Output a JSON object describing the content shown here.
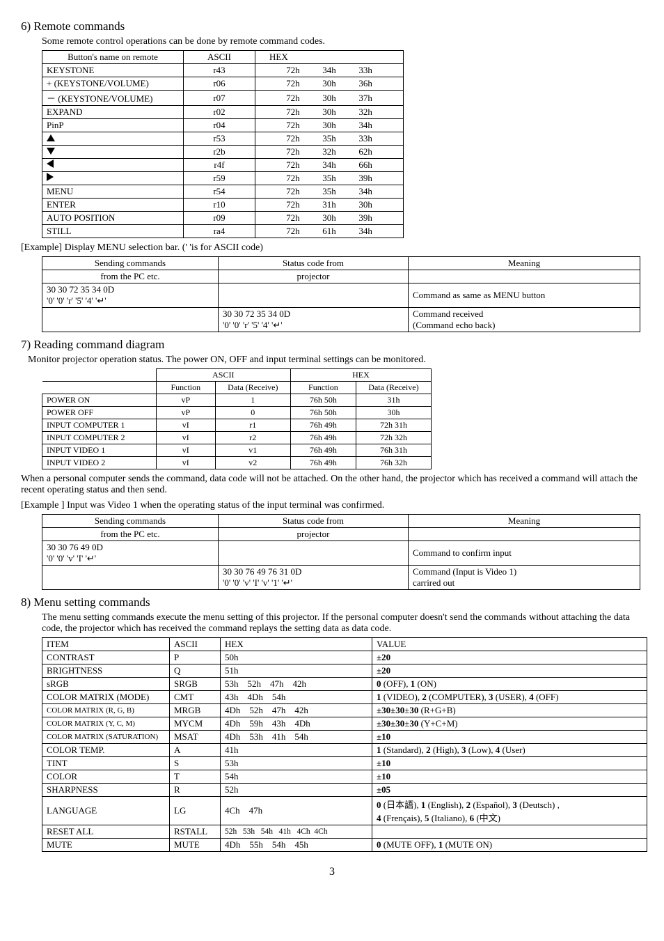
{
  "sec6": {
    "heading": "6) Remote commands",
    "intro": "Some remote control operations can be done by remote command codes.",
    "headers": [
      "Button's name on remote",
      "ASCII",
      "HEX",
      "",
      ""
    ],
    "rows": [
      {
        "name": "KEYSTONE",
        "icon": "",
        "ascii": "r43",
        "h1": "72h",
        "h2": "34h",
        "h3": "33h"
      },
      {
        "name": "+ (KEYSTONE/VOLUME)",
        "icon": "",
        "ascii": "r06",
        "h1": "72h",
        "h2": "30h",
        "h3": "36h"
      },
      {
        "name": "－ (KEYSTONE/VOLUME)",
        "icon": "",
        "ascii": "r07",
        "h1": "72h",
        "h2": "30h",
        "h3": "37h"
      },
      {
        "name": "EXPAND",
        "icon": "",
        "ascii": "r02",
        "h1": "72h",
        "h2": "30h",
        "h3": "32h"
      },
      {
        "name": "PinP",
        "icon": "",
        "ascii": "r04",
        "h1": "72h",
        "h2": "30h",
        "h3": "34h"
      },
      {
        "name": "",
        "icon": "up",
        "ascii": "r53",
        "h1": "72h",
        "h2": "35h",
        "h3": "33h"
      },
      {
        "name": "",
        "icon": "down",
        "ascii": "r2b",
        "h1": "72h",
        "h2": "32h",
        "h3": "62h"
      },
      {
        "name": "",
        "icon": "left",
        "ascii": "r4f",
        "h1": "72h",
        "h2": "34h",
        "h3": "66h"
      },
      {
        "name": "",
        "icon": "right",
        "ascii": "r59",
        "h1": "72h",
        "h2": "35h",
        "h3": "39h"
      },
      {
        "name": "MENU",
        "icon": "",
        "ascii": "r54",
        "h1": "72h",
        "h2": "35h",
        "h3": "34h"
      },
      {
        "name": "ENTER",
        "icon": "",
        "ascii": "r10",
        "h1": "72h",
        "h2": "31h",
        "h3": "30h"
      },
      {
        "name": "AUTO POSITION",
        "icon": "",
        "ascii": "r09",
        "h1": "72h",
        "h2": "30h",
        "h3": "39h"
      },
      {
        "name": "STILL",
        "icon": "",
        "ascii": "ra4",
        "h1": "72h",
        "h2": "61h",
        "h3": "34h"
      }
    ],
    "example_label": "[Example] Display MENU selection bar. ('  'is for ASCII code)",
    "ex_headers": [
      "Sending commands",
      "Status code from",
      "Meaning"
    ],
    "ex_header2": [
      "from the PC etc.",
      "projector",
      ""
    ],
    "ex_row1": {
      "send1": "30 30 72 35 34 0D",
      "send2": "'0' '0' 'r' '5' '4' '↵'",
      "status": "",
      "meaning": "Command as same as MENU button"
    },
    "ex_row2": {
      "send": "",
      "status1": "30 30 72 35 34 0D",
      "status2": "'0' '0' 'r' '5' '4' '↵'",
      "meaning1": "Command received",
      "meaning2": "(Command echo back)"
    }
  },
  "sec7": {
    "heading": "7) Reading command diagram",
    "intro": "Monitor projector operation status. The power ON, OFF and input terminal settings can be monitored.",
    "headers_top": [
      "",
      "ASCII",
      "HEX"
    ],
    "headers_sub": [
      "",
      "Function",
      "Data (Receive)",
      "Function",
      "Data (Receive)"
    ],
    "rows": [
      {
        "label": "POWER ON",
        "af": "vP",
        "ad": "1",
        "hf": "76h 50h",
        "hd": "31h"
      },
      {
        "label": "POWER OFF",
        "af": "vP",
        "ad": "0",
        "hf": "76h 50h",
        "hd": "30h"
      },
      {
        "label": "INPUT COMPUTER 1",
        "af": "vI",
        "ad": "r1",
        "hf": "76h 49h",
        "hd": "72h 31h"
      },
      {
        "label": "INPUT COMPUTER 2",
        "af": "vI",
        "ad": "r2",
        "hf": "76h 49h",
        "hd": "72h 32h"
      },
      {
        "label": "INPUT VIDEO 1",
        "af": "vI",
        "ad": "v1",
        "hf": "76h 49h",
        "hd": "76h 31h"
      },
      {
        "label": "INPUT VIDEO 2",
        "af": "vI",
        "ad": "v2",
        "hf": "76h 49h",
        "hd": "76h 32h"
      }
    ],
    "note": "When a personal computer sends the command, data code will not be attached. On the other hand, the projector which has received a command will attach the recent operating status and then send.",
    "example_label": "[Example ]   Input  was Video 1 when the operating status of the input terminal was confirmed.",
    "ex_headers": [
      "Sending commands",
      "Status code from",
      "Meaning"
    ],
    "ex_header2": [
      "from the PC etc.",
      "projector",
      ""
    ],
    "ex_row1": {
      "send1": "30 30 76 49 0D",
      "send2": "'0' '0' 'v' 'I' '↵'",
      "status": "",
      "meaning": "Command to confirm input"
    },
    "ex_row2": {
      "send": "",
      "status1": "30 30 76 49 76 31 0D",
      "status2": "'0' '0' 'v' 'I' 'v' '1' '↵'",
      "meaning1": "Command (Input is Video 1)",
      "meaning2": "carrired out"
    }
  },
  "sec8": {
    "heading": "8) Menu setting commands",
    "intro": "The menu setting commands execute the menu setting of this projector. If the personal computer doesn't send the commands without attaching the data code, the projector which has received the command replays the setting data as data code.",
    "headers": [
      "ITEM",
      "ASCII",
      "HEX",
      "VALUE"
    ],
    "rows": [
      {
        "item": "CONTRAST",
        "ascii": "P",
        "hex": "50h",
        "value": "±20"
      },
      {
        "item": "BRIGHTNESS",
        "ascii": "Q",
        "hex": "51h",
        "value": "±20"
      },
      {
        "item": "sRGB",
        "ascii": "SRGB",
        "hex": "53h    52h    47h    42h",
        "value": "0 (OFF), 1 (ON)"
      },
      {
        "item": "COLOR MATRIX (MODE)",
        "ascii": "CMT",
        "hex": "43h    4Dh    54h",
        "value": "1 (VIDEO), 2 (COMPUTER), 3 (USER), 4 (OFF)"
      },
      {
        "item": "COLOR MATRIX (R, G, B)",
        "ascii": "MRGB",
        "hex": "4Dh    52h    47h    42h",
        "value": "±30±30±30  (R+G+B)"
      },
      {
        "item": "COLOR MATRIX (Y, C, M)",
        "ascii": "MYCM",
        "hex": "4Dh    59h    43h    4Dh",
        "value": "±30±30±30  (Y+C+M)"
      },
      {
        "item": "COLOR MATRIX (SATURATION)",
        "ascii": "MSAT",
        "hex": "4Dh    53h    41h    54h",
        "value": "±10"
      },
      {
        "item": "COLOR TEMP.",
        "ascii": "A",
        "hex": "41h",
        "value": "1 (Standard), 2 (High), 3 (Low), 4 (User)"
      },
      {
        "item": "TINT",
        "ascii": "S",
        "hex": "53h",
        "value": "±10"
      },
      {
        "item": "COLOR",
        "ascii": "T",
        "hex": "54h",
        "value": "±10"
      },
      {
        "item": "SHARPNESS",
        "ascii": "R",
        "hex": "52h",
        "value": "±05"
      },
      {
        "item": "LANGUAGE",
        "ascii": "LG",
        "hex": "4Ch    47h",
        "value": "0 (日本語), 1 (English), 2 (Español), 3 (Deutsch) ,\n4 (Frençais),  5 (Italiano), 6 (中文)"
      },
      {
        "item": "RESET ALL",
        "ascii": "RSTALL",
        "hex": "52h   53h   54h   41h   4Ch  4Ch",
        "value": ""
      },
      {
        "item": "MUTE",
        "ascii": "MUTE",
        "hex": "4Dh    55h    54h    45h",
        "value": "0 (MUTE OFF), 1 (MUTE ON)"
      }
    ]
  },
  "page": "3"
}
